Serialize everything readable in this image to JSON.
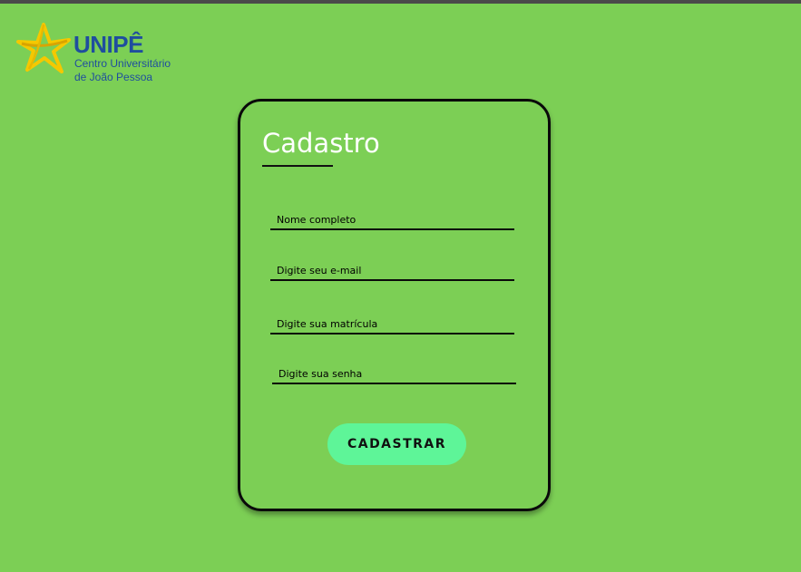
{
  "logo": {
    "title": "UNIPÊ",
    "subtitle_line1": "Centro Universitário",
    "subtitle_line2": "de João Pessoa",
    "icon": "star-logo-icon"
  },
  "form": {
    "title": "Cadastro",
    "fields": [
      {
        "placeholder": "Nome completo",
        "value": ""
      },
      {
        "placeholder": "Digite seu e-mail",
        "value": ""
      },
      {
        "placeholder": "Digite sua matrícula",
        "value": ""
      },
      {
        "placeholder": "Digite sua senha",
        "value": ""
      }
    ],
    "submit_label": "CADASTRAR"
  },
  "colors": {
    "background": "#7ccf55",
    "button": "#5ef598",
    "brand_blue": "#1f4e9e",
    "brand_yellow": "#f5c800"
  }
}
